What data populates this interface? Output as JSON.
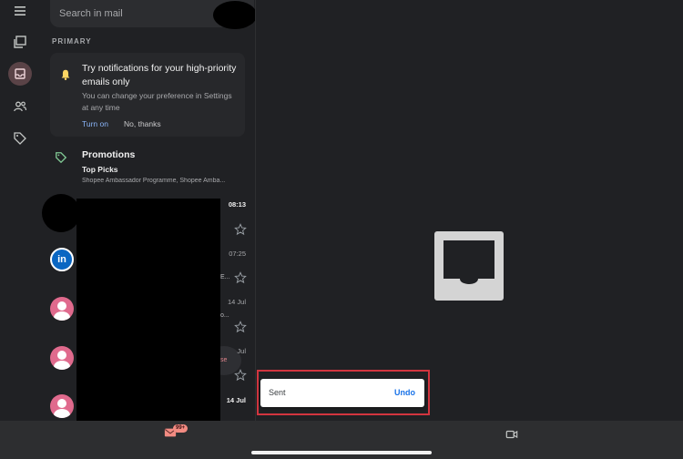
{
  "search": {
    "placeholder": "Search in mail"
  },
  "section_label": "PRIMARY",
  "notification": {
    "title": "Try notifications for your high-priority emails only",
    "description": "You can change your preference in Settings at any time",
    "turn_on": "Turn on",
    "no_thanks": "No, thanks"
  },
  "promotions": {
    "title": "Promotions",
    "subtitle": "Top Picks",
    "preview": "Shopee Ambassador Programme, Shopee Amba..."
  },
  "rows": [
    {
      "date": "08:13"
    },
    {
      "date": "07:25",
      "avatar": "in",
      "fragment": "E..."
    },
    {
      "date": "14 Jul",
      "fragment": "o..."
    },
    {
      "date": "Jul",
      "fragment": "se"
    },
    {
      "date": "14 Jul"
    }
  ],
  "snackbar": {
    "message": "Sent",
    "action": "Undo"
  },
  "bottom_nav": {
    "badge": "99+"
  },
  "colors": {
    "accent_blue": "#8ab4f8",
    "snackbar_outline": "#d2353f",
    "badge": "#f28b82"
  }
}
